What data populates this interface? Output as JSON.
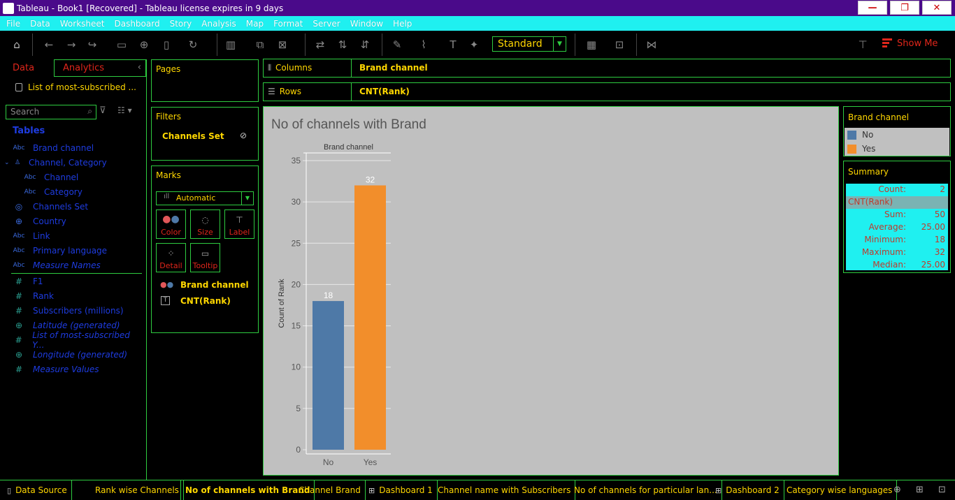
{
  "window": {
    "title": "Tableau - Book1 [Recovered] - Tableau license expires in 9 days",
    "minimize": "—",
    "restore": "❐",
    "close": "✕"
  },
  "menu": [
    "File",
    "Data",
    "Worksheet",
    "Dashboard",
    "Story",
    "Analysis",
    "Map",
    "Format",
    "Server",
    "Window",
    "Help"
  ],
  "toolbar": {
    "fit_value": "Standard",
    "show_me": "Show Me"
  },
  "data_pane": {
    "tab_data": "Data",
    "tab_analytics": "Analytics",
    "source": "List of most-subscribed ...",
    "search_placeholder": "Search",
    "tables_header": "Tables",
    "dimensions": [
      {
        "type": "Abc",
        "name": "Brand channel"
      },
      {
        "type": "hier",
        "name": "Channel, Category"
      },
      {
        "type": "Abc",
        "name": "Channel"
      },
      {
        "type": "Abc",
        "name": "Category"
      },
      {
        "type": "set",
        "name": "Channels Set"
      },
      {
        "type": "geo",
        "name": "Country"
      },
      {
        "type": "Abc",
        "name": "Link"
      },
      {
        "type": "Abc",
        "name": "Primary language"
      },
      {
        "type": "Abc",
        "name": "Measure Names"
      }
    ],
    "measures": [
      {
        "type": "#",
        "name": "F1"
      },
      {
        "type": "#",
        "name": "Rank"
      },
      {
        "type": "#",
        "name": "Subscribers (millions)"
      },
      {
        "type": "geo",
        "name": "Latitude (generated)"
      },
      {
        "type": "#",
        "name": "List of most-subscribed Y..."
      },
      {
        "type": "geo",
        "name": "Longitude (generated)"
      },
      {
        "type": "#",
        "name": "Measure Values"
      }
    ]
  },
  "cards": {
    "pages": "Pages",
    "filters": "Filters",
    "filter_item": "Channels Set",
    "marks": "Marks",
    "mark_type": "Automatic",
    "mark_buttons": [
      "Color",
      "Size",
      "Label",
      "Detail",
      "Tooltip"
    ],
    "mark_fields": [
      "Brand channel",
      "CNT(Rank)"
    ]
  },
  "shelves": {
    "columns_label": "Columns",
    "columns_value": "Brand channel",
    "rows_label": "Rows",
    "rows_value": "CNT(Rank)"
  },
  "viz": {
    "title": "No of channels with Brand"
  },
  "legend": {
    "title": "Brand channel",
    "items": [
      {
        "label": "No",
        "color": "#4e79a7"
      },
      {
        "label": "Yes",
        "color": "#f28e2b"
      }
    ]
  },
  "summary": {
    "title": "Summary",
    "count_label": "Count:",
    "count_value": "2",
    "field": "CNT(Rank)",
    "stats": [
      {
        "k": "Sum:",
        "v": "50"
      },
      {
        "k": "Average:",
        "v": "25.00"
      },
      {
        "k": "Minimum:",
        "v": "18"
      },
      {
        "k": "Maximum:",
        "v": "32"
      },
      {
        "k": "Median:",
        "v": "25.00"
      }
    ]
  },
  "bottom_tabs": [
    {
      "label": "Data Source",
      "kind": "source"
    },
    {
      "label": "Rank wise Channels",
      "kind": "sheet"
    },
    {
      "label": "No of channels with Brand",
      "kind": "sheet",
      "active": true
    },
    {
      "label": "Channel Brand",
      "kind": "sheet"
    },
    {
      "label": "Dashboard 1",
      "kind": "dashboard"
    },
    {
      "label": "Channel name with Subscribers",
      "kind": "sheet"
    },
    {
      "label": "No of channels for particular lan...",
      "kind": "sheet"
    },
    {
      "label": "Dashboard 2",
      "kind": "dashboard"
    },
    {
      "label": "Category wise languages",
      "kind": "sheet"
    }
  ],
  "chart_data": {
    "type": "bar",
    "header": "Brand channel",
    "categories": [
      "No",
      "Yes"
    ],
    "values": [
      18,
      32
    ],
    "colors": [
      "#4e79a7",
      "#f28e2b"
    ],
    "ylabel": "Count of Rank",
    "ylim": [
      0,
      35
    ],
    "yticks": [
      0,
      5,
      10,
      15,
      20,
      25,
      30,
      35
    ],
    "grid": true
  }
}
